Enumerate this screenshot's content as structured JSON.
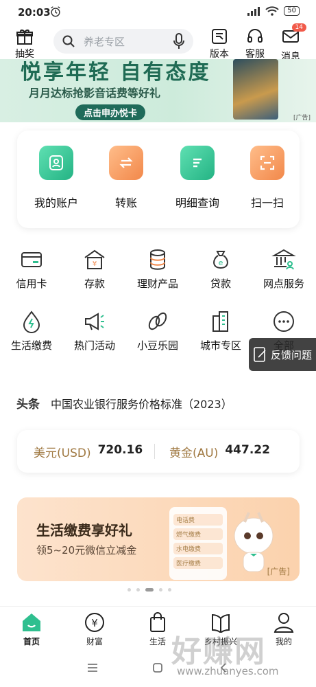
{
  "status": {
    "time": "20:03",
    "battery": "50"
  },
  "header": {
    "lottery_label": "抽奖",
    "search_placeholder": "养老专区",
    "version_label": "版本",
    "service_label": "客服",
    "message_label": "消息",
    "message_badge": "14"
  },
  "banner": {
    "title": "悦享年轻 自有态度",
    "subtitle": "月月达标抢影音话费等好礼",
    "button": "点击申办悦卡",
    "ad_tag": "[广告]"
  },
  "quick_actions": [
    {
      "label": "我的账户",
      "icon": "account-icon",
      "color": "#2fbf8f"
    },
    {
      "label": "转账",
      "icon": "transfer-icon",
      "color": "#f59a5c"
    },
    {
      "label": "明细查询",
      "icon": "statement-icon",
      "color": "#2fbf8f"
    },
    {
      "label": "扫一扫",
      "icon": "scan-icon",
      "color": "#f59a5c"
    }
  ],
  "services_row1": [
    {
      "label": "信用卡",
      "icon": "credit-card-icon"
    },
    {
      "label": "存款",
      "icon": "deposit-icon"
    },
    {
      "label": "理财产品",
      "icon": "wealth-product-icon"
    },
    {
      "label": "贷款",
      "icon": "loan-icon"
    },
    {
      "label": "网点服务",
      "icon": "branch-service-icon"
    }
  ],
  "services_row2": [
    {
      "label": "生活缴费",
      "icon": "utility-payment-icon"
    },
    {
      "label": "热门活动",
      "icon": "hot-activity-icon"
    },
    {
      "label": "小豆乐园",
      "icon": "bean-park-icon"
    },
    {
      "label": "城市专区",
      "icon": "city-zone-icon"
    },
    {
      "label": "全部",
      "icon": "more-icon"
    }
  ],
  "feedback": {
    "label": "反馈问题"
  },
  "news": {
    "tag": "头条",
    "text": "中国农业银行服务价格标准（2023）"
  },
  "rates": {
    "usd_label": "美元(USD)",
    "usd_value": "720.16",
    "gold_label": "黄金(AU)",
    "gold_value": "447.22"
  },
  "promo": {
    "title": "生活缴费享好礼",
    "subtitle": "领5~20元微信立减金",
    "ad_tag": "[广告]",
    "card_items": [
      "电话费",
      "燃气缴费",
      "水电缴费",
      "医疗缴费"
    ]
  },
  "tabs": [
    {
      "label": "首页",
      "icon": "home-icon",
      "active": true
    },
    {
      "label": "财富",
      "icon": "wealth-icon",
      "active": false
    },
    {
      "label": "生活",
      "icon": "life-bag-icon",
      "active": false
    },
    {
      "label": "乡村振兴",
      "icon": "rural-book-icon",
      "active": false
    },
    {
      "label": "我的",
      "icon": "profile-icon",
      "active": false
    }
  ],
  "watermark": {
    "brand": "好赚网",
    "url": "www.zhuanyes.com"
  },
  "colors": {
    "brand_green": "#2fbf8f",
    "accent_orange": "#f59a5c",
    "gold_text": "#a07942"
  }
}
